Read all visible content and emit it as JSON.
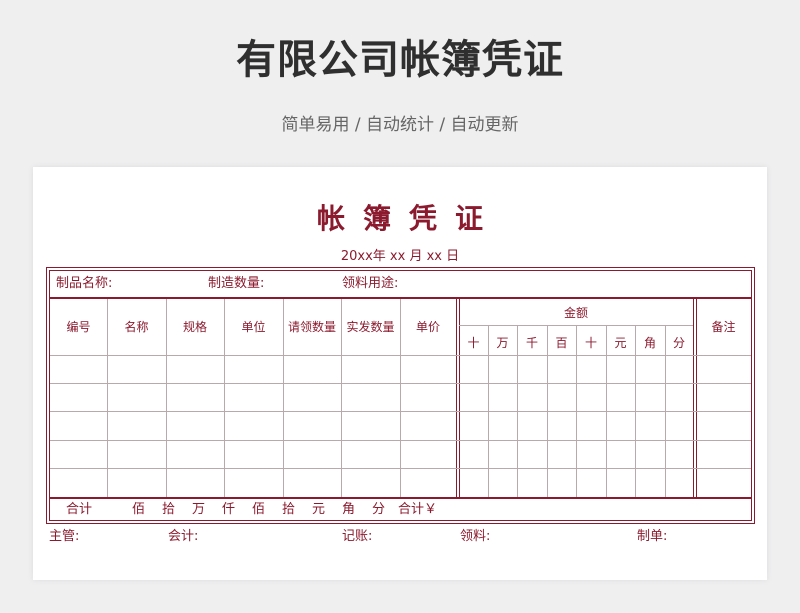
{
  "header": {
    "title": "有限公司帐簿凭证",
    "subtitle": "简单易用 / 自动统计 / 自动更新"
  },
  "form": {
    "title": "帐簿凭证",
    "date": "20xx年  xx 月  xx 日",
    "info": {
      "product_name": "制品名称:",
      "quantity": "制造数量:",
      "purpose": "领料用途:"
    },
    "columns": [
      "编号",
      "名称",
      "规格",
      "单位",
      "请领数量",
      "实发数量",
      "单价"
    ],
    "amount_label": "金额",
    "amount_digits": [
      "十",
      "万",
      "千",
      "百",
      "十",
      "元",
      "角",
      "分"
    ],
    "remark": "备注",
    "totals": {
      "label": "合计",
      "units": [
        "佰",
        "拾",
        "万",
        "仟",
        "佰",
        "拾",
        "元",
        "角",
        "分"
      ],
      "total_yen": "合计￥"
    },
    "signatures": [
      "主管:",
      "会计:",
      "记账:",
      "领料:",
      "制单:"
    ],
    "accent_color": "#8b1a2e"
  }
}
